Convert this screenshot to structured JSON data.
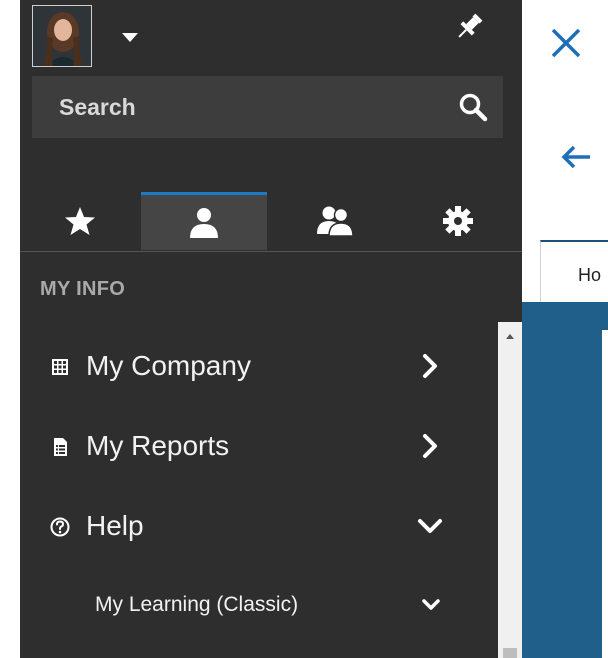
{
  "sidebar": {
    "user": {
      "avatar_icon": "user-photo",
      "menu_icon": "caret-down-icon"
    },
    "pin_icon": "pin-icon",
    "search": {
      "label": "Search",
      "icon": "search-icon"
    },
    "tabs": [
      {
        "name": "favorites",
        "icon": "star-icon",
        "active": false
      },
      {
        "name": "my-info",
        "icon": "person-icon",
        "active": true
      },
      {
        "name": "team",
        "icon": "people-icon",
        "active": false
      },
      {
        "name": "settings",
        "icon": "gear-icon",
        "active": false
      }
    ],
    "section_title": "MY INFO",
    "items": [
      {
        "label": "My Company",
        "icon": "building-icon",
        "chevron": "chevron-right-icon"
      },
      {
        "label": "My Reports",
        "icon": "report-icon",
        "chevron": "chevron-right-icon"
      },
      {
        "label": "Help",
        "icon": "help-circle-icon",
        "chevron": "chevron-down-icon"
      }
    ],
    "sub_items": [
      {
        "label": "My Learning (Classic)",
        "chevron": "chevron-down-icon"
      }
    ]
  },
  "page": {
    "close_icon": "close-icon",
    "back_icon": "arrow-left-icon",
    "tab_label": "Ho"
  },
  "colors": {
    "sidebar_bg": "#2e2e2e",
    "accent": "#1e7bc5",
    "page_blue": "#1f5f8a"
  }
}
